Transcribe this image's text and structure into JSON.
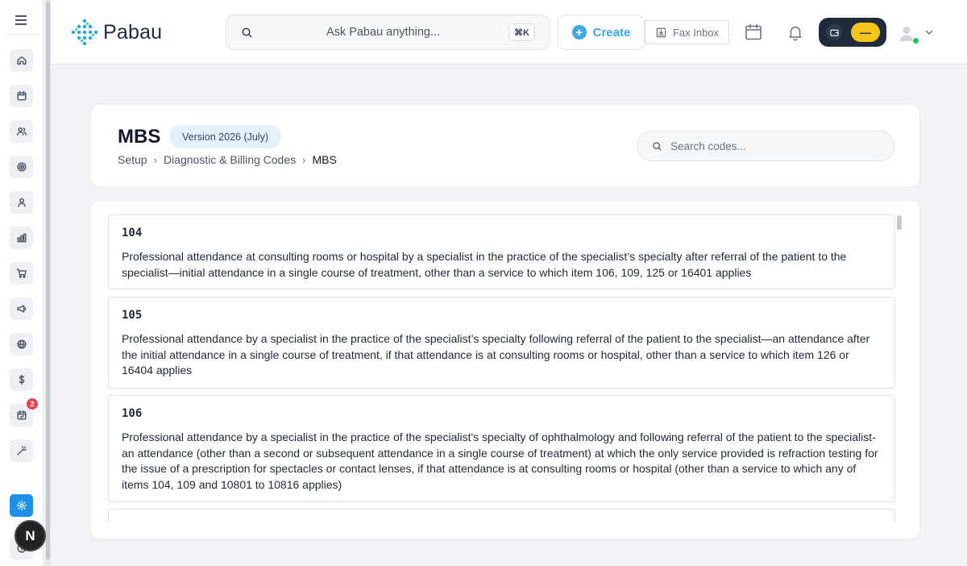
{
  "app": {
    "logo_text": "Pabau"
  },
  "topbar": {
    "search_placeholder": "Ask Pabau anything...",
    "search_shortcut": "⌘K",
    "create_label": "Create",
    "fax_label": "Fax Inbox",
    "toggle_pill": "—"
  },
  "sidebar": {
    "items": [
      {
        "name": "home",
        "icon": "home-icon"
      },
      {
        "name": "calendar",
        "icon": "calendar-icon"
      },
      {
        "name": "clients",
        "icon": "users-icon"
      },
      {
        "name": "targets",
        "icon": "target-icon"
      },
      {
        "name": "staff",
        "icon": "user-icon"
      },
      {
        "name": "reports",
        "icon": "bar-chart-icon"
      },
      {
        "name": "store",
        "icon": "cart-icon"
      },
      {
        "name": "marketing",
        "icon": "megaphone-icon"
      },
      {
        "name": "online",
        "icon": "globe-icon"
      },
      {
        "name": "financials",
        "icon": "dollar-icon"
      },
      {
        "name": "tasks",
        "icon": "calendar-check-icon",
        "badge": "2"
      },
      {
        "name": "tools",
        "icon": "magic-wand-icon"
      },
      {
        "name": "setup",
        "icon": "settings-icon",
        "active": true
      }
    ],
    "user_initial": "N"
  },
  "header": {
    "title": "MBS",
    "version_badge": "Version 2026 (July)",
    "breadcrumb": [
      "Setup",
      "Diagnostic & Billing Codes",
      "MBS"
    ],
    "search_placeholder": "Search codes..."
  },
  "codes": [
    {
      "code": "104",
      "description": "Professional attendance at consulting rooms or hospital by a specialist in the practice of the specialist’s specialty after referral of the patient to the specialist—initial attendance in a single course of treatment, other than a service to which item 106, 109, 125 or 16401 applies"
    },
    {
      "code": "105",
      "description": "Professional attendance by a specialist in the practice of the specialist’s specialty following referral of the patient to the specialist—an attendance after the initial attendance in a single course of treatment, if that attendance is at consulting rooms or hospital, other than a service to which item 126 or 16404 applies"
    },
    {
      "code": "106",
      "description": "Professional attendance by a specialist in the practice of the specialist's specialty of ophthalmology and following referral of the patient to the specialist-an attendance (other than a second or subsequent attendance in a single course of treatment) at which the only service provided is refraction testing for the issue of a prescription for spectacles or contact lenses, if that attendance is at consulting rooms or hospital (other than a service to which any of items 104, 109 and 10801 to 10816 applies)"
    }
  ],
  "colors": {
    "accent": "#40a8e0",
    "active_nav": "#1e8fe8",
    "badge": "#e5484d",
    "toggle_bg": "#1f2a3c",
    "toggle_pill": "#f5c518",
    "online_dot": "#22c55e"
  }
}
